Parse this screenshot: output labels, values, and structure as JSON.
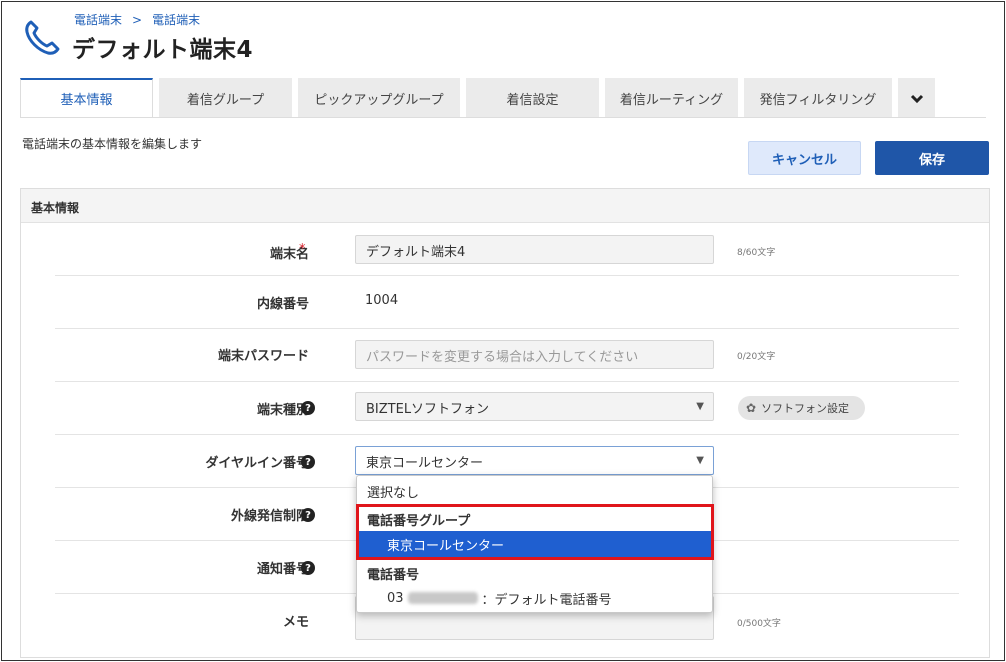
{
  "header": {
    "breadcrumb": [
      "電話端末",
      "電話端末"
    ],
    "breadcrumb_sep": ">",
    "title": "デフォルト端末4"
  },
  "tabs": [
    {
      "label": "基本情報",
      "active": true
    },
    {
      "label": "着信グループ"
    },
    {
      "label": "ピックアップグループ"
    },
    {
      "label": "着信設定"
    },
    {
      "label": "着信ルーティング"
    },
    {
      "label": "発信フィルタリング"
    }
  ],
  "tab_more_icon": "chevron-down-icon",
  "description": "電話端末の基本情報を編集します",
  "buttons": {
    "cancel": "キャンセル",
    "save": "保存"
  },
  "panel": {
    "title": "基本情報",
    "fields": {
      "name": {
        "label": "端末名",
        "required_mark": "*",
        "value": "デフォルト端末4",
        "counter": "8/60文字"
      },
      "extension": {
        "label": "内線番号",
        "value": "1004"
      },
      "password": {
        "label": "端末パスワード",
        "placeholder": "パスワードを変更する場合は入力してください",
        "counter": "0/20文字"
      },
      "device_type": {
        "label": "端末種別",
        "value": "BIZTELソフトフォン",
        "settings_button": "ソフトフォン設定"
      },
      "dial_in": {
        "label": "ダイヤルイン番号",
        "value": "東京コールセンター"
      },
      "outbound_limit": {
        "label": "外線発信制限"
      },
      "caller_id": {
        "label": "通知番号"
      },
      "memo": {
        "label": "メモ",
        "counter": "0/500文字"
      }
    }
  },
  "dropdown": {
    "none_option": "選択なし",
    "group1": {
      "label": "電話番号グループ",
      "options": [
        "東京コールセンター"
      ]
    },
    "group2": {
      "label": "電話番号",
      "option_prefix": "03",
      "option_suffix": "：デフォルト電話番号"
    }
  },
  "colors": {
    "accent": "#1f5fb7",
    "primary_button": "#1f56a8",
    "highlight_border": "#e0151b",
    "selected_option": "#1f5fd0"
  }
}
